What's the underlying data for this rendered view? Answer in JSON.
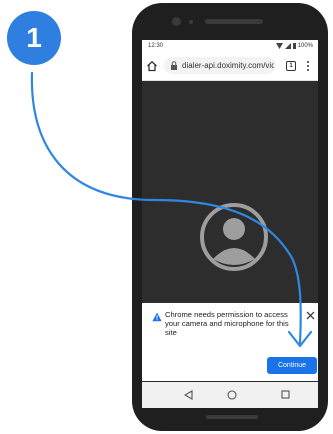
{
  "step": {
    "number": "1"
  },
  "status_bar": {
    "time": "12:30",
    "battery": "100%"
  },
  "browser": {
    "url": "dialer-api.doximity.com/vid",
    "tab_count": "1"
  },
  "permission_dialog": {
    "message": "Chrome needs permission to access your camera and microphone for this site",
    "continue_label": "Continue"
  },
  "colors": {
    "step_badge": "#2e7fe0",
    "continue_button": "#1a73e8",
    "arrow": "#2f87e3"
  },
  "icons": {
    "home": "home-icon",
    "lock": "lock-icon",
    "tab_switcher": "tab-switcher-icon",
    "menu": "more-vert-icon",
    "avatar": "account-circle-icon",
    "warning": "warning-icon",
    "close": "close-icon",
    "nav_back": "nav-back-icon",
    "nav_home": "nav-home-icon",
    "nav_recent": "nav-recent-icon"
  }
}
